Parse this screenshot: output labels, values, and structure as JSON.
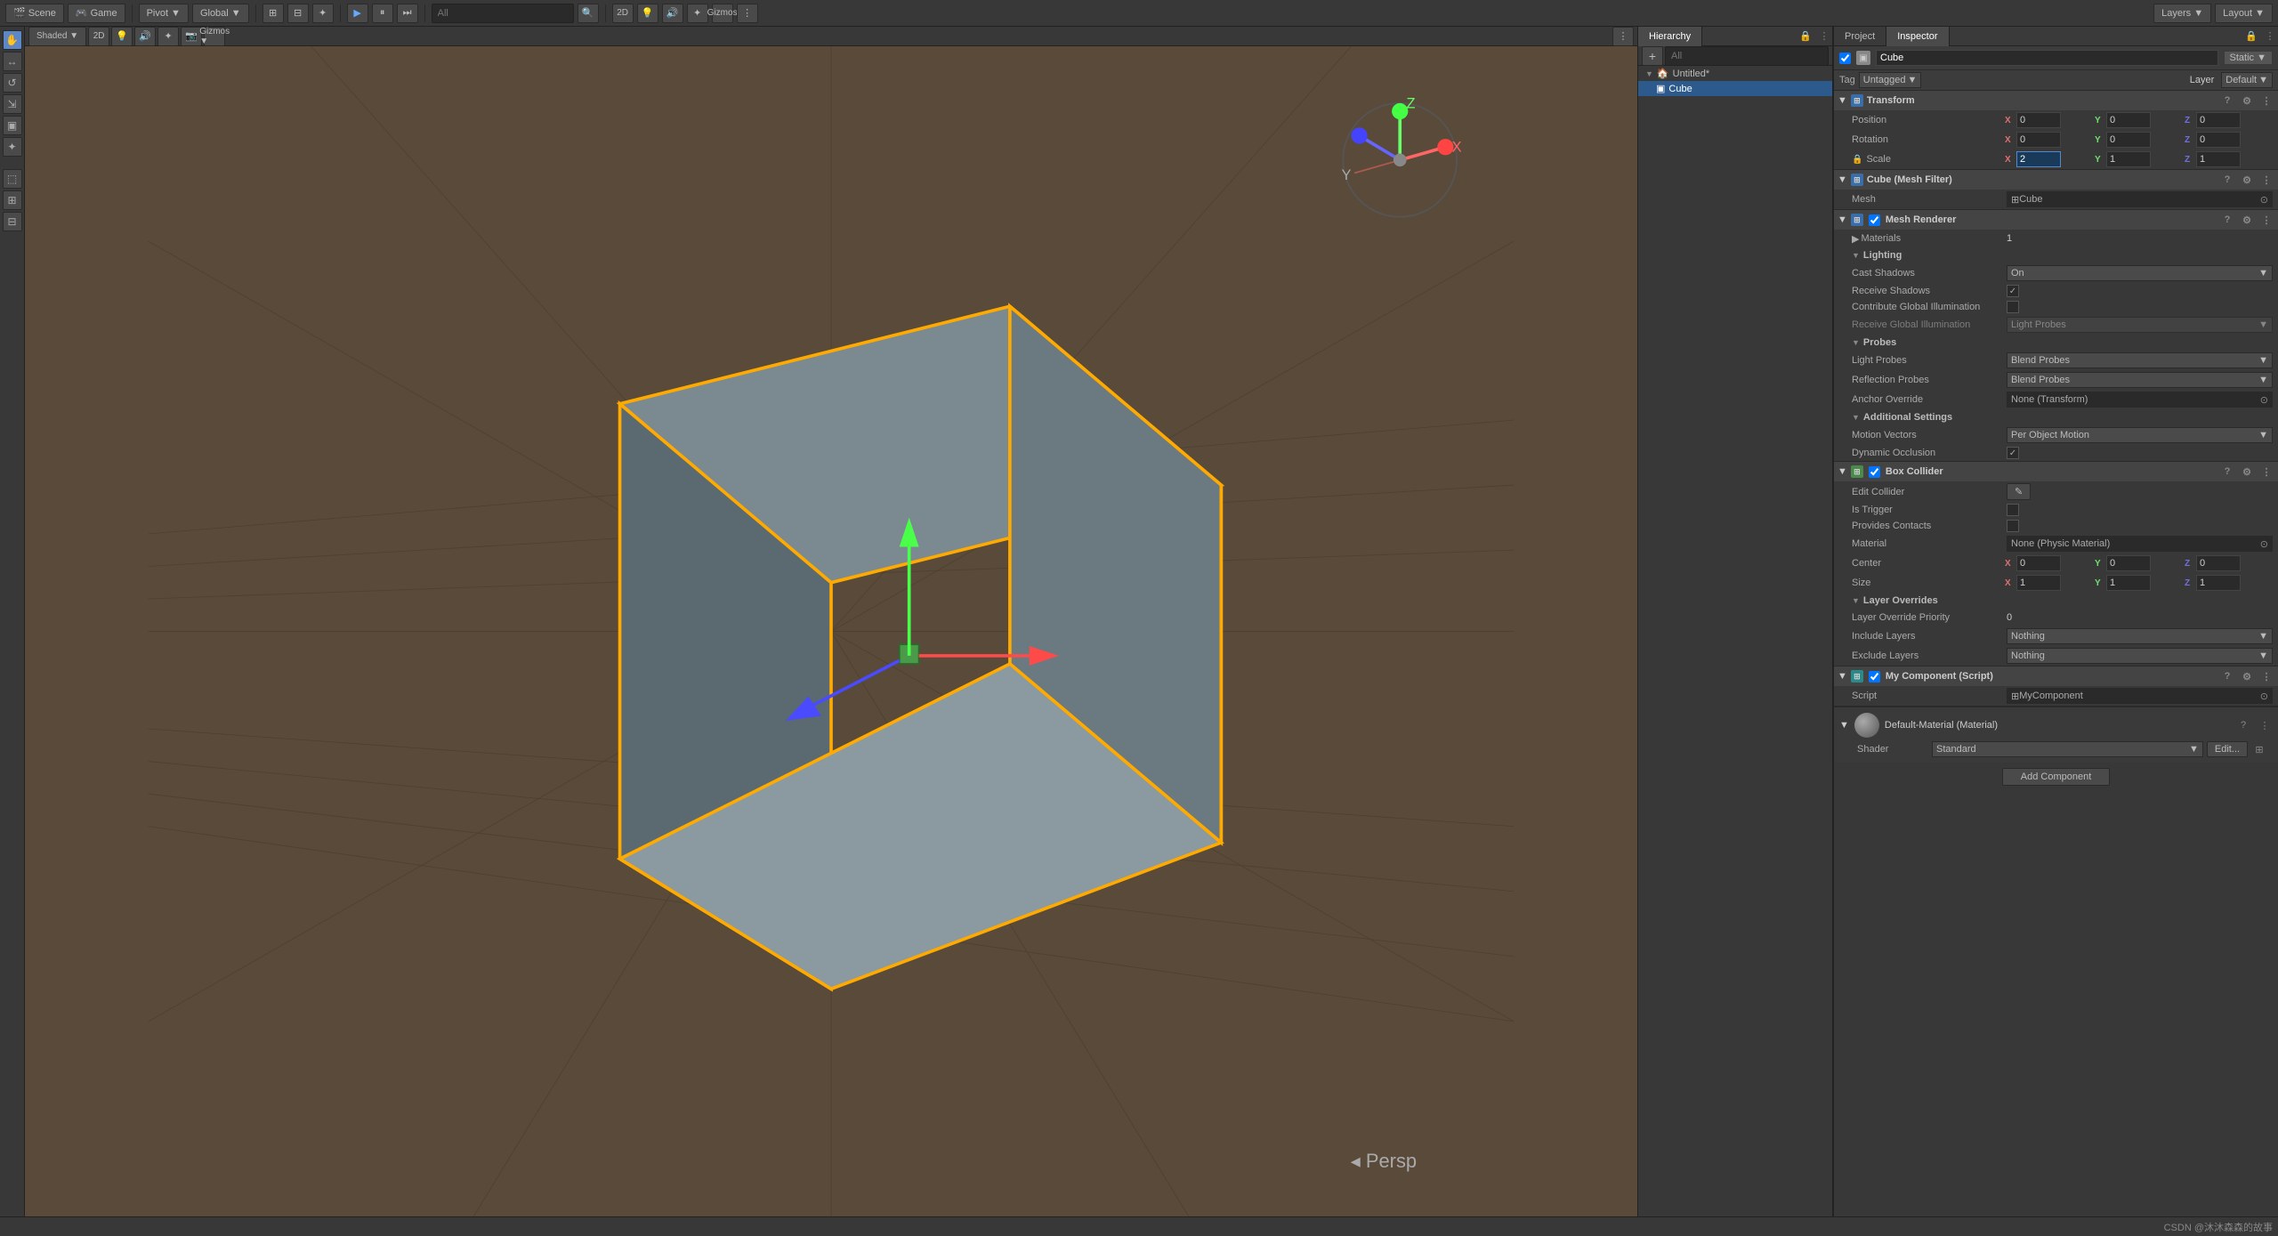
{
  "app": {
    "title": "Unity Editor"
  },
  "topToolbar": {
    "pivot_label": "Pivot",
    "global_label": "Global",
    "play_icon": "▶",
    "pause_icon": "⏸",
    "step_icon": "⏭",
    "search_placeholder": "All",
    "layers_label": "Layers",
    "layout_label": "Layout",
    "scene_tab": "Scene",
    "game_tab": "Game"
  },
  "leftTools": {
    "tools": [
      "✋",
      "↔",
      "↺",
      "⇲",
      "▣",
      "✦",
      "⬚",
      "⊞",
      "⊟"
    ]
  },
  "hierarchy": {
    "title": "Hierarchy",
    "search_placeholder": "All",
    "items": [
      {
        "label": "Untitled*",
        "indent": 0,
        "selected": false,
        "arrow": "▼"
      },
      {
        "label": "Cube",
        "indent": 1,
        "selected": true,
        "arrow": ""
      }
    ]
  },
  "inspector": {
    "title": "Inspector",
    "project_tab": "Project",
    "inspector_tab": "Inspector",
    "object_name": "Cube",
    "static_label": "Static",
    "tag_label": "Tag",
    "tag_value": "Untagged",
    "layer_label": "Layer",
    "layer_value": "Default",
    "components": {
      "transform": {
        "title": "Transform",
        "icon": "⊞",
        "position_label": "Position",
        "rotation_label": "Rotation",
        "scale_label": "Scale",
        "position": {
          "x": "0",
          "y": "0",
          "z": "0"
        },
        "rotation": {
          "x": "0",
          "y": "0",
          "z": "0"
        },
        "scale": {
          "x": "2",
          "y": "1",
          "z": "1"
        }
      },
      "meshFilter": {
        "title": "Cube (Mesh Filter)",
        "icon": "⊞",
        "mesh_label": "Mesh",
        "mesh_value": "Cube"
      },
      "meshRenderer": {
        "title": "Mesh Renderer",
        "icon": "⊞",
        "materials_label": "Materials",
        "materials_count": "1",
        "lighting": {
          "title": "Lighting",
          "cast_shadows_label": "Cast Shadows",
          "cast_shadows_value": "On",
          "receive_shadows_label": "Receive Shadows",
          "receive_shadows_checked": true,
          "contribute_gi_label": "Contribute Global Illumination",
          "contribute_gi_checked": false,
          "receive_gi_label": "Receive Global Illumination",
          "receive_gi_value": "Light Probes"
        },
        "probes": {
          "title": "Probes",
          "light_probes_label": "Light Probes",
          "light_probes_value": "Blend Probes",
          "reflection_probes_label": "Reflection Probes",
          "reflection_probes_value": "Blend Probes",
          "anchor_override_label": "Anchor Override",
          "anchor_override_value": "None (Transform)"
        },
        "additional": {
          "title": "Additional Settings",
          "motion_vectors_label": "Motion Vectors",
          "motion_vectors_value": "Per Object Motion",
          "dynamic_occlusion_label": "Dynamic Occlusion",
          "dynamic_occlusion_checked": true
        }
      },
      "boxCollider": {
        "title": "Box Collider",
        "icon": "⊞",
        "edit_collider_label": "Edit Collider",
        "is_trigger_label": "Is Trigger",
        "is_trigger_checked": false,
        "provides_contacts_label": "Provides Contacts",
        "provides_contacts_checked": false,
        "material_label": "Material",
        "material_value": "None (Physic Material)",
        "center_label": "Center",
        "center": {
          "x": "0",
          "y": "0",
          "z": "0"
        },
        "size_label": "Size",
        "size": {
          "x": "1",
          "y": "1",
          "z": "1"
        },
        "layer_overrides": {
          "title": "Layer Overrides",
          "priority_label": "Layer Override Priority",
          "priority_value": "0",
          "include_layers_label": "Include Layers",
          "include_layers_value": "Nothing",
          "exclude_layers_label": "Exclude Layers",
          "exclude_layers_value": "Nothing"
        }
      },
      "myComponent": {
        "title": "My Component (Script)",
        "icon": "⊞",
        "script_label": "Script",
        "script_value": "MyComponent"
      },
      "material": {
        "title": "Default-Material (Material)",
        "shader_label": "Shader",
        "shader_value": "Standard",
        "edit_label": "Edit..."
      }
    }
  },
  "bottomBar": {
    "watermark": "CSDN @沐沐森森的故事"
  }
}
